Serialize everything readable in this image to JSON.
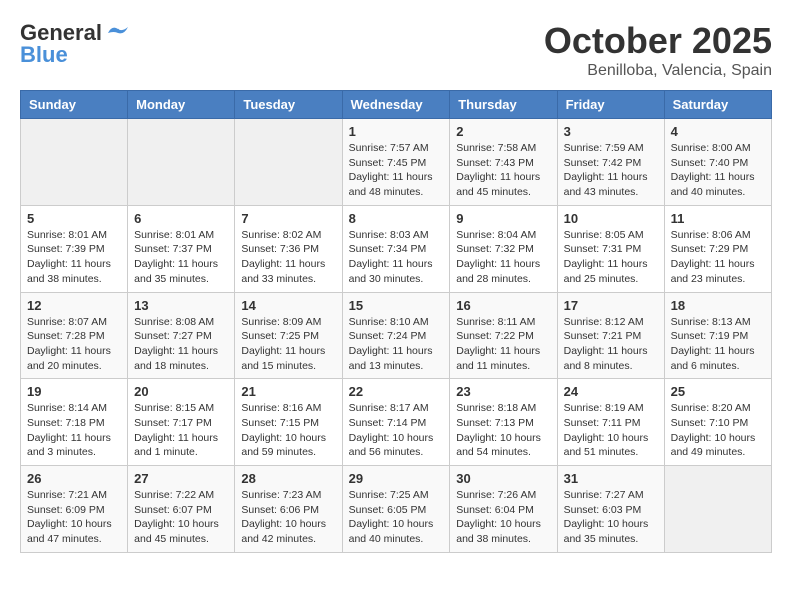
{
  "header": {
    "logo_general": "General",
    "logo_blue": "Blue",
    "month": "October 2025",
    "location": "Benilloba, Valencia, Spain"
  },
  "days_of_week": [
    "Sunday",
    "Monday",
    "Tuesday",
    "Wednesday",
    "Thursday",
    "Friday",
    "Saturday"
  ],
  "weeks": [
    [
      {
        "day": "",
        "sunrise": "",
        "sunset": "",
        "daylight": ""
      },
      {
        "day": "",
        "sunrise": "",
        "sunset": "",
        "daylight": ""
      },
      {
        "day": "",
        "sunrise": "",
        "sunset": "",
        "daylight": ""
      },
      {
        "day": "1",
        "sunrise": "Sunrise: 7:57 AM",
        "sunset": "Sunset: 7:45 PM",
        "daylight": "Daylight: 11 hours and 48 minutes."
      },
      {
        "day": "2",
        "sunrise": "Sunrise: 7:58 AM",
        "sunset": "Sunset: 7:43 PM",
        "daylight": "Daylight: 11 hours and 45 minutes."
      },
      {
        "day": "3",
        "sunrise": "Sunrise: 7:59 AM",
        "sunset": "Sunset: 7:42 PM",
        "daylight": "Daylight: 11 hours and 43 minutes."
      },
      {
        "day": "4",
        "sunrise": "Sunrise: 8:00 AM",
        "sunset": "Sunset: 7:40 PM",
        "daylight": "Daylight: 11 hours and 40 minutes."
      }
    ],
    [
      {
        "day": "5",
        "sunrise": "Sunrise: 8:01 AM",
        "sunset": "Sunset: 7:39 PM",
        "daylight": "Daylight: 11 hours and 38 minutes."
      },
      {
        "day": "6",
        "sunrise": "Sunrise: 8:01 AM",
        "sunset": "Sunset: 7:37 PM",
        "daylight": "Daylight: 11 hours and 35 minutes."
      },
      {
        "day": "7",
        "sunrise": "Sunrise: 8:02 AM",
        "sunset": "Sunset: 7:36 PM",
        "daylight": "Daylight: 11 hours and 33 minutes."
      },
      {
        "day": "8",
        "sunrise": "Sunrise: 8:03 AM",
        "sunset": "Sunset: 7:34 PM",
        "daylight": "Daylight: 11 hours and 30 minutes."
      },
      {
        "day": "9",
        "sunrise": "Sunrise: 8:04 AM",
        "sunset": "Sunset: 7:32 PM",
        "daylight": "Daylight: 11 hours and 28 minutes."
      },
      {
        "day": "10",
        "sunrise": "Sunrise: 8:05 AM",
        "sunset": "Sunset: 7:31 PM",
        "daylight": "Daylight: 11 hours and 25 minutes."
      },
      {
        "day": "11",
        "sunrise": "Sunrise: 8:06 AM",
        "sunset": "Sunset: 7:29 PM",
        "daylight": "Daylight: 11 hours and 23 minutes."
      }
    ],
    [
      {
        "day": "12",
        "sunrise": "Sunrise: 8:07 AM",
        "sunset": "Sunset: 7:28 PM",
        "daylight": "Daylight: 11 hours and 20 minutes."
      },
      {
        "day": "13",
        "sunrise": "Sunrise: 8:08 AM",
        "sunset": "Sunset: 7:27 PM",
        "daylight": "Daylight: 11 hours and 18 minutes."
      },
      {
        "day": "14",
        "sunrise": "Sunrise: 8:09 AM",
        "sunset": "Sunset: 7:25 PM",
        "daylight": "Daylight: 11 hours and 15 minutes."
      },
      {
        "day": "15",
        "sunrise": "Sunrise: 8:10 AM",
        "sunset": "Sunset: 7:24 PM",
        "daylight": "Daylight: 11 hours and 13 minutes."
      },
      {
        "day": "16",
        "sunrise": "Sunrise: 8:11 AM",
        "sunset": "Sunset: 7:22 PM",
        "daylight": "Daylight: 11 hours and 11 minutes."
      },
      {
        "day": "17",
        "sunrise": "Sunrise: 8:12 AM",
        "sunset": "Sunset: 7:21 PM",
        "daylight": "Daylight: 11 hours and 8 minutes."
      },
      {
        "day": "18",
        "sunrise": "Sunrise: 8:13 AM",
        "sunset": "Sunset: 7:19 PM",
        "daylight": "Daylight: 11 hours and 6 minutes."
      }
    ],
    [
      {
        "day": "19",
        "sunrise": "Sunrise: 8:14 AM",
        "sunset": "Sunset: 7:18 PM",
        "daylight": "Daylight: 11 hours and 3 minutes."
      },
      {
        "day": "20",
        "sunrise": "Sunrise: 8:15 AM",
        "sunset": "Sunset: 7:17 PM",
        "daylight": "Daylight: 11 hours and 1 minute."
      },
      {
        "day": "21",
        "sunrise": "Sunrise: 8:16 AM",
        "sunset": "Sunset: 7:15 PM",
        "daylight": "Daylight: 10 hours and 59 minutes."
      },
      {
        "day": "22",
        "sunrise": "Sunrise: 8:17 AM",
        "sunset": "Sunset: 7:14 PM",
        "daylight": "Daylight: 10 hours and 56 minutes."
      },
      {
        "day": "23",
        "sunrise": "Sunrise: 8:18 AM",
        "sunset": "Sunset: 7:13 PM",
        "daylight": "Daylight: 10 hours and 54 minutes."
      },
      {
        "day": "24",
        "sunrise": "Sunrise: 8:19 AM",
        "sunset": "Sunset: 7:11 PM",
        "daylight": "Daylight: 10 hours and 51 minutes."
      },
      {
        "day": "25",
        "sunrise": "Sunrise: 8:20 AM",
        "sunset": "Sunset: 7:10 PM",
        "daylight": "Daylight: 10 hours and 49 minutes."
      }
    ],
    [
      {
        "day": "26",
        "sunrise": "Sunrise: 7:21 AM",
        "sunset": "Sunset: 6:09 PM",
        "daylight": "Daylight: 10 hours and 47 minutes."
      },
      {
        "day": "27",
        "sunrise": "Sunrise: 7:22 AM",
        "sunset": "Sunset: 6:07 PM",
        "daylight": "Daylight: 10 hours and 45 minutes."
      },
      {
        "day": "28",
        "sunrise": "Sunrise: 7:23 AM",
        "sunset": "Sunset: 6:06 PM",
        "daylight": "Daylight: 10 hours and 42 minutes."
      },
      {
        "day": "29",
        "sunrise": "Sunrise: 7:25 AM",
        "sunset": "Sunset: 6:05 PM",
        "daylight": "Daylight: 10 hours and 40 minutes."
      },
      {
        "day": "30",
        "sunrise": "Sunrise: 7:26 AM",
        "sunset": "Sunset: 6:04 PM",
        "daylight": "Daylight: 10 hours and 38 minutes."
      },
      {
        "day": "31",
        "sunrise": "Sunrise: 7:27 AM",
        "sunset": "Sunset: 6:03 PM",
        "daylight": "Daylight: 10 hours and 35 minutes."
      },
      {
        "day": "",
        "sunrise": "",
        "sunset": "",
        "daylight": ""
      }
    ]
  ]
}
